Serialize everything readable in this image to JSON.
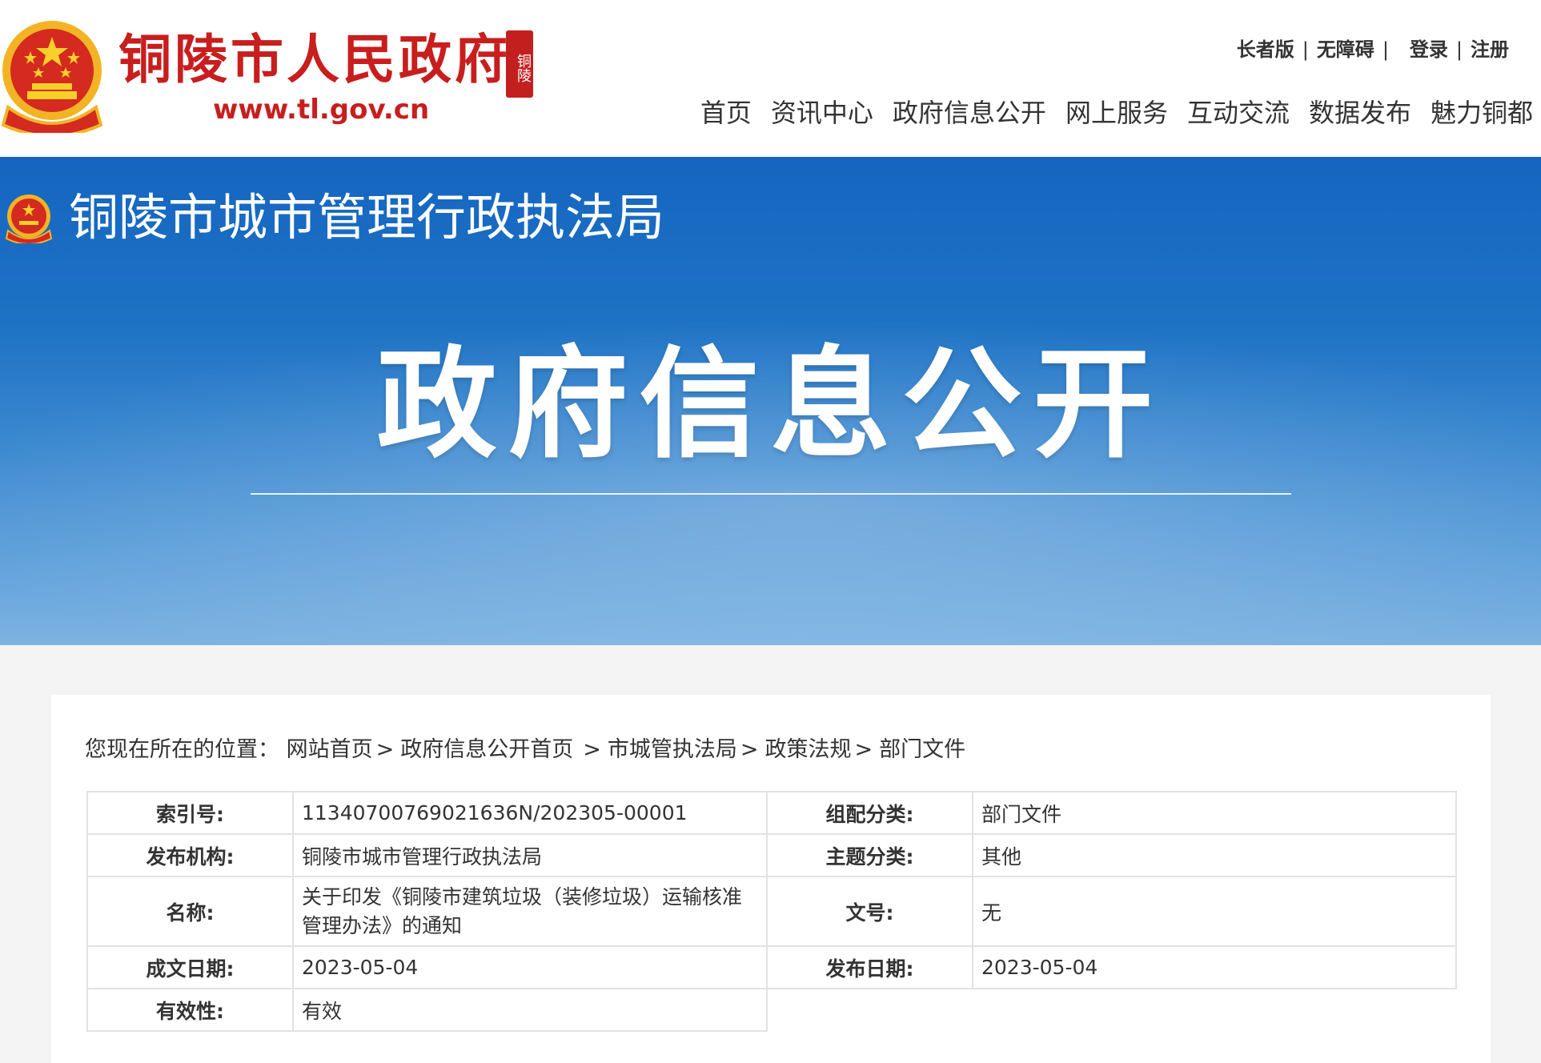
{
  "header": {
    "site_title": "铜陵市人民政府",
    "site_url": "www.tl.gov.cn",
    "seal_text": "铜陵",
    "top_links": [
      "长者版",
      "无障碍",
      "登录",
      "注册"
    ],
    "nav": [
      "首页",
      "资讯中心",
      "政府信息公开",
      "网上服务",
      "互动交流",
      "数据发布",
      "魅力铜都"
    ]
  },
  "banner": {
    "bureau_name": "铜陵市城市管理行政执法局",
    "heading": "政府信息公开"
  },
  "breadcrumb": {
    "prefix": "您现在所在的位置：",
    "items": [
      "网站首页",
      "政府信息公开首页",
      "市城管执法局",
      "政策法规",
      "部门文件"
    ],
    "separator": ">"
  },
  "meta": {
    "index_no": {
      "label": "索引号:",
      "value": "11340700769021636N/202305-00001"
    },
    "category": {
      "label": "组配分类:",
      "value": "部门文件"
    },
    "publisher": {
      "label": "发布机构:",
      "value": "铜陵市城市管理行政执法局"
    },
    "topic": {
      "label": "主题分类:",
      "value": "其他"
    },
    "name": {
      "label": "名称:",
      "value": "关于印发《铜陵市建筑垃圾（装修垃圾）运输核准管理办法》的通知"
    },
    "doc_no": {
      "label": "文号:",
      "value": "无"
    },
    "written_date": {
      "label": "成文日期:",
      "value": "2023-05-04"
    },
    "publish_date": {
      "label": "发布日期:",
      "value": "2023-05-04"
    },
    "validity": {
      "label": "有效性:",
      "value": "有效"
    }
  },
  "colors": {
    "brand_red": "#c81e1e",
    "banner_blue": "#1565c0",
    "page_bg": "#f4f4f4"
  }
}
